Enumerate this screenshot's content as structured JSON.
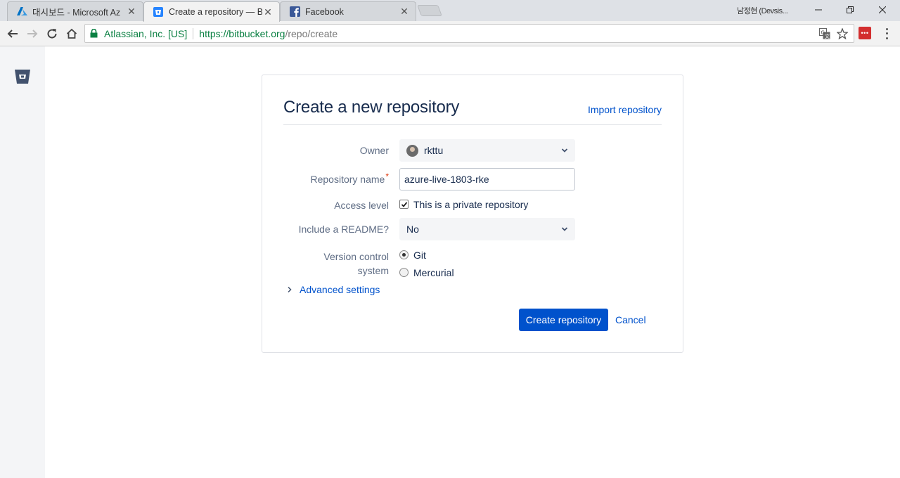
{
  "browser": {
    "tabs": [
      {
        "title": "대시보드 - Microsoft Az",
        "icon": "azure-icon",
        "active": false
      },
      {
        "title": "Create a repository — B",
        "icon": "bitbucket-icon",
        "active": true
      },
      {
        "title": "Facebook",
        "icon": "facebook-icon",
        "active": false
      }
    ],
    "profile_name": "남정현 (Devsis...",
    "address": {
      "org": "Atlassian, Inc. [US]",
      "url_host": "https://bitbucket.org",
      "url_path": "/repo/create"
    }
  },
  "page": {
    "title": "Create a new repository",
    "import_link": "Import repository",
    "form": {
      "owner_label": "Owner",
      "owner_value": "rkttu",
      "repo_name_label": "Repository name",
      "repo_name_required": "*",
      "repo_name_value": "azure-live-1803-rke",
      "access_label": "Access level",
      "private_label": "This is a private repository",
      "private_checked": true,
      "readme_label": "Include a README?",
      "readme_value": "No",
      "vcs_label_line1": "Version control",
      "vcs_label_line2": "system",
      "vcs_options": [
        {
          "label": "Git",
          "selected": true
        },
        {
          "label": "Mercurial",
          "selected": false
        }
      ],
      "advanced_label": "Advanced settings",
      "create_button": "Create repository",
      "cancel_button": "Cancel"
    }
  },
  "colors": {
    "primary": "#0052cc",
    "title_text": "#172b4d",
    "label_text": "#5e6c84",
    "secure_green": "#0b8043"
  }
}
